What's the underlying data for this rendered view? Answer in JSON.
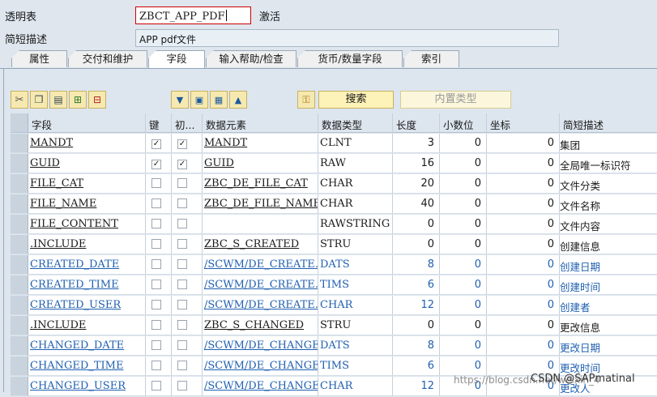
{
  "header": {
    "table_label": "透明表",
    "table_name": "ZBCT_APP_PDF",
    "status": "激活",
    "desc_label": "简短描述",
    "description": "APP pdf文件"
  },
  "tabs": [
    {
      "label": "属性"
    },
    {
      "label": "交付和维护"
    },
    {
      "label": "字段"
    },
    {
      "label": "输入帮助/检查"
    },
    {
      "label": "货币/数量字段"
    },
    {
      "label": "索引"
    }
  ],
  "toolbar": {
    "search_label": "搜索",
    "builtin_label": "内置类型"
  },
  "columns": [
    "字段",
    "键",
    "初...",
    "数据元素",
    "数据类型",
    "长度",
    "小数位",
    "坐标",
    "简短描述"
  ],
  "rows": [
    {
      "field": "MANDT",
      "key": "✓",
      "init": "✓",
      "element": "MANDT",
      "type": "CLNT",
      "length": "3",
      "decimals": "0",
      "coord": "0",
      "desc": "集团"
    },
    {
      "field": "GUID",
      "key": "✓",
      "init": "✓",
      "element": "GUID",
      "type": "RAW",
      "length": "16",
      "decimals": "0",
      "coord": "0",
      "desc": "全局唯一标识符"
    },
    {
      "field": "FILE_CAT",
      "key": "",
      "init": "",
      "element": "ZBC_DE_FILE_CAT",
      "type": "CHAR",
      "length": "20",
      "decimals": "0",
      "coord": "0",
      "desc": "文件分类"
    },
    {
      "field": "FILE_NAME",
      "key": "",
      "init": "",
      "element": "ZBC_DE_FILE_NAME",
      "type": "CHAR",
      "length": "40",
      "decimals": "0",
      "coord": "0",
      "desc": "文件名称"
    },
    {
      "field": "FILE_CONTENT",
      "key": "",
      "init": "",
      "element": "",
      "type": "RAWSTRING",
      "length": "0",
      "decimals": "0",
      "coord": "0",
      "desc": "文件内容"
    },
    {
      "field": ".INCLUDE",
      "key": "",
      "init": "",
      "element": "ZBC_S_CREATED",
      "type": "STRU",
      "length": "0",
      "decimals": "0",
      "coord": "0",
      "desc": "创建信息"
    },
    {
      "field": "CREATED_DATE",
      "key": "",
      "init": "",
      "element": "/SCWM/DE_CREATE…",
      "type": "DATS",
      "length": "8",
      "decimals": "0",
      "coord": "0",
      "desc": "创建日期",
      "blue": true
    },
    {
      "field": "CREATED_TIME",
      "key": "",
      "init": "",
      "element": "/SCWM/DE_CREATE…",
      "type": "TIMS",
      "length": "6",
      "decimals": "0",
      "coord": "0",
      "desc": "创建时间",
      "blue": true
    },
    {
      "field": "CREATED_USER",
      "key": "",
      "init": "",
      "element": "/SCWM/DE_CREATE…",
      "type": "CHAR",
      "length": "12",
      "decimals": "0",
      "coord": "0",
      "desc": "创建者",
      "blue": true
    },
    {
      "field": ".INCLUDE",
      "key": "",
      "init": "",
      "element": "ZBC_S_CHANGED",
      "type": "STRU",
      "length": "0",
      "decimals": "0",
      "coord": "0",
      "desc": "更改信息"
    },
    {
      "field": "CHANGED_DATE",
      "key": "",
      "init": "",
      "element": "/SCWM/DE_CHANGE…",
      "type": "DATS",
      "length": "8",
      "decimals": "0",
      "coord": "0",
      "desc": "更改日期",
      "blue": true
    },
    {
      "field": "CHANGED_TIME",
      "key": "",
      "init": "",
      "element": "/SCWM/DE_CHANGE…",
      "type": "TIMS",
      "length": "6",
      "decimals": "0",
      "coord": "0",
      "desc": "更改时间",
      "blue": true
    },
    {
      "field": "CHANGED_USER",
      "key": "",
      "init": "",
      "element": "/SCWM/DE_CHANGE…",
      "type": "CHAR",
      "length": "12",
      "decimals": "0",
      "coord": "0",
      "desc": "更改人",
      "blue": true
    }
  ],
  "watermark": {
    "url": "https://blog.csdn.net/weixin_4",
    "author": "CSDN @SAPmatinal"
  },
  "colors": {
    "accent_red": "#cc0000",
    "link_blue": "#2060b0",
    "button_yellow": "#fdf2b7"
  }
}
